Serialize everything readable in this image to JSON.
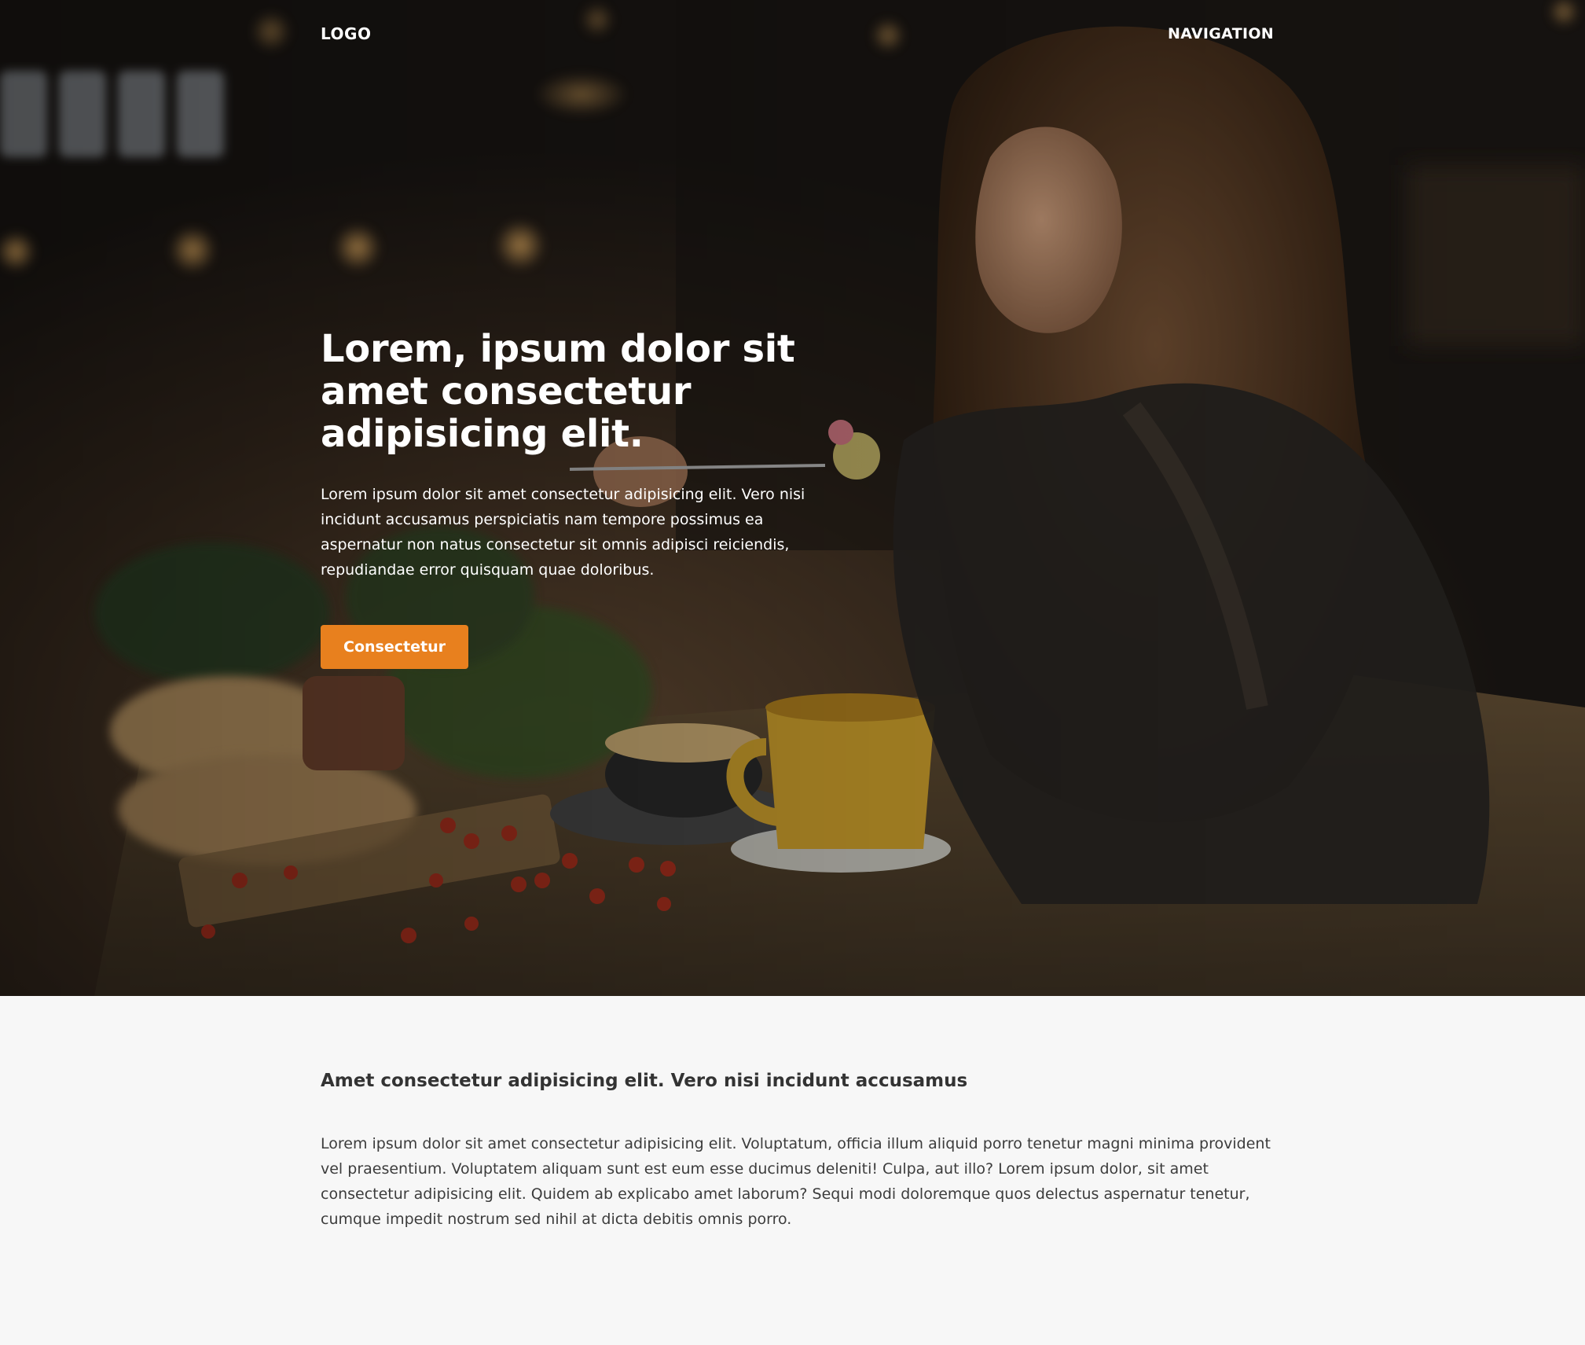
{
  "header": {
    "logo": "LOGO",
    "navigation": "NAVIGATION"
  },
  "hero": {
    "title": "Lorem, ipsum dolor sit amet consectetur adipisicing elit.",
    "text": "Lorem ipsum dolor sit amet consectetur adipisicing elit. Vero nisi incidunt accusamus perspiciatis nam tempore possimus ea aspernatur non natus consectetur sit omnis adipisci reiciendis, repudiandae error quisquam quae doloribus.",
    "cta_label": "Consectetur",
    "cta_color": "#e8801e"
  },
  "section": {
    "heading": "Amet consectetur adipisicing elit. Vero nisi incidunt accusamus",
    "text": "Lorem ipsum dolor sit amet consectetur adipisicing elit. Voluptatum, officia illum aliquid porro tenetur magni minima provident vel praesentium. Voluptatem aliquam sunt est eum esse ducimus deleniti! Culpa, aut illo? Lorem ipsum dolor, sit amet consectetur adipisicing elit. Quidem ab explicabo amet laborum? Sequi modi doloremque quos delectus aspernatur tenetur, cumque impedit nostrum sed nihil at dicta debitis omnis porro."
  }
}
